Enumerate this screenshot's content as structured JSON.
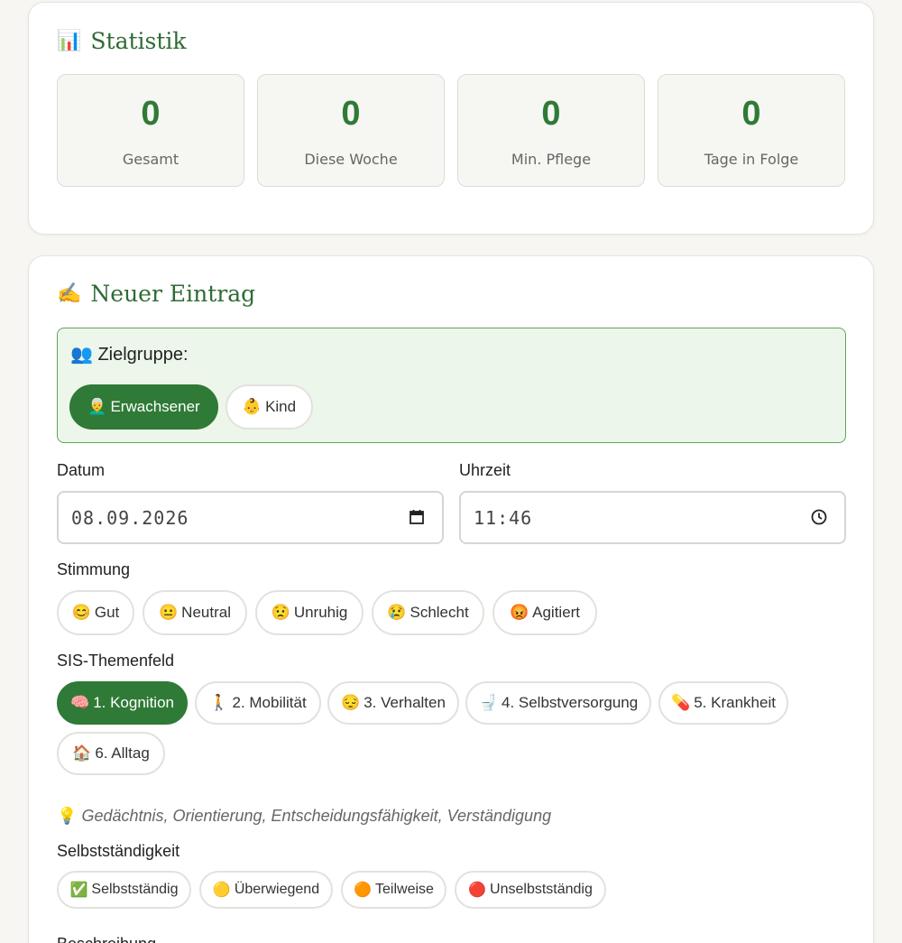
{
  "stats": {
    "title": "Statistik",
    "title_icon": "📊",
    "items": [
      {
        "value": "0",
        "label": "Gesamt"
      },
      {
        "value": "0",
        "label": "Diese Woche"
      },
      {
        "value": "0",
        "label": "Min. Pflege"
      },
      {
        "value": "0",
        "label": "Tage in Folge"
      }
    ]
  },
  "entry": {
    "title": "Neuer Eintrag",
    "title_icon": "✍",
    "target_group": {
      "label": "👥 Zielgruppe:",
      "options": [
        {
          "icon": "👨‍🦳",
          "label": "Erwachsener",
          "selected": true
        },
        {
          "icon": "👶",
          "label": "Kind",
          "selected": false
        }
      ]
    },
    "date_label": "Datum",
    "date_value": "08.09.2026",
    "time_label": "Uhrzeit",
    "time_value": "11:46",
    "mood": {
      "label": "Stimmung",
      "options": [
        {
          "icon": "😊",
          "label": "Gut"
        },
        {
          "icon": "😐",
          "label": "Neutral"
        },
        {
          "icon": "😟",
          "label": "Unruhig"
        },
        {
          "icon": "😢",
          "label": "Schlecht"
        },
        {
          "icon": "😡",
          "label": "Agitiert"
        }
      ]
    },
    "sis": {
      "label": "SIS-Themenfeld",
      "options": [
        {
          "icon": "🧠",
          "label": "1. Kognition",
          "selected": true
        },
        {
          "icon": "🚶",
          "label": "2. Mobilität",
          "selected": false
        },
        {
          "icon": "😔",
          "label": "3. Verhalten",
          "selected": false
        },
        {
          "icon": "🚽",
          "label": "4. Selbstversorgung",
          "selected": false
        },
        {
          "icon": "💊",
          "label": "5. Krankheit",
          "selected": false
        },
        {
          "icon": "🏠",
          "label": "6. Alltag",
          "selected": false
        }
      ],
      "hint_icon": "💡",
      "hint": "Gedächtnis, Orientierung, Entscheidungsfähigkeit, Verständigung"
    },
    "independence": {
      "label": "Selbstständigkeit",
      "options": [
        {
          "icon": "✅",
          "label": "Selbstständig"
        },
        {
          "icon": "🟡",
          "label": "Überwiegend"
        },
        {
          "icon": "🟠",
          "label": "Teilweise"
        },
        {
          "icon": "🔴",
          "label": "Unselbstständig"
        }
      ]
    },
    "description_label": "Beschreibung"
  },
  "colors": {
    "accent": "#2f7a36",
    "title_green": "#2f6b35",
    "target_bg": "#edf6ea",
    "target_border": "#5fa55b"
  }
}
